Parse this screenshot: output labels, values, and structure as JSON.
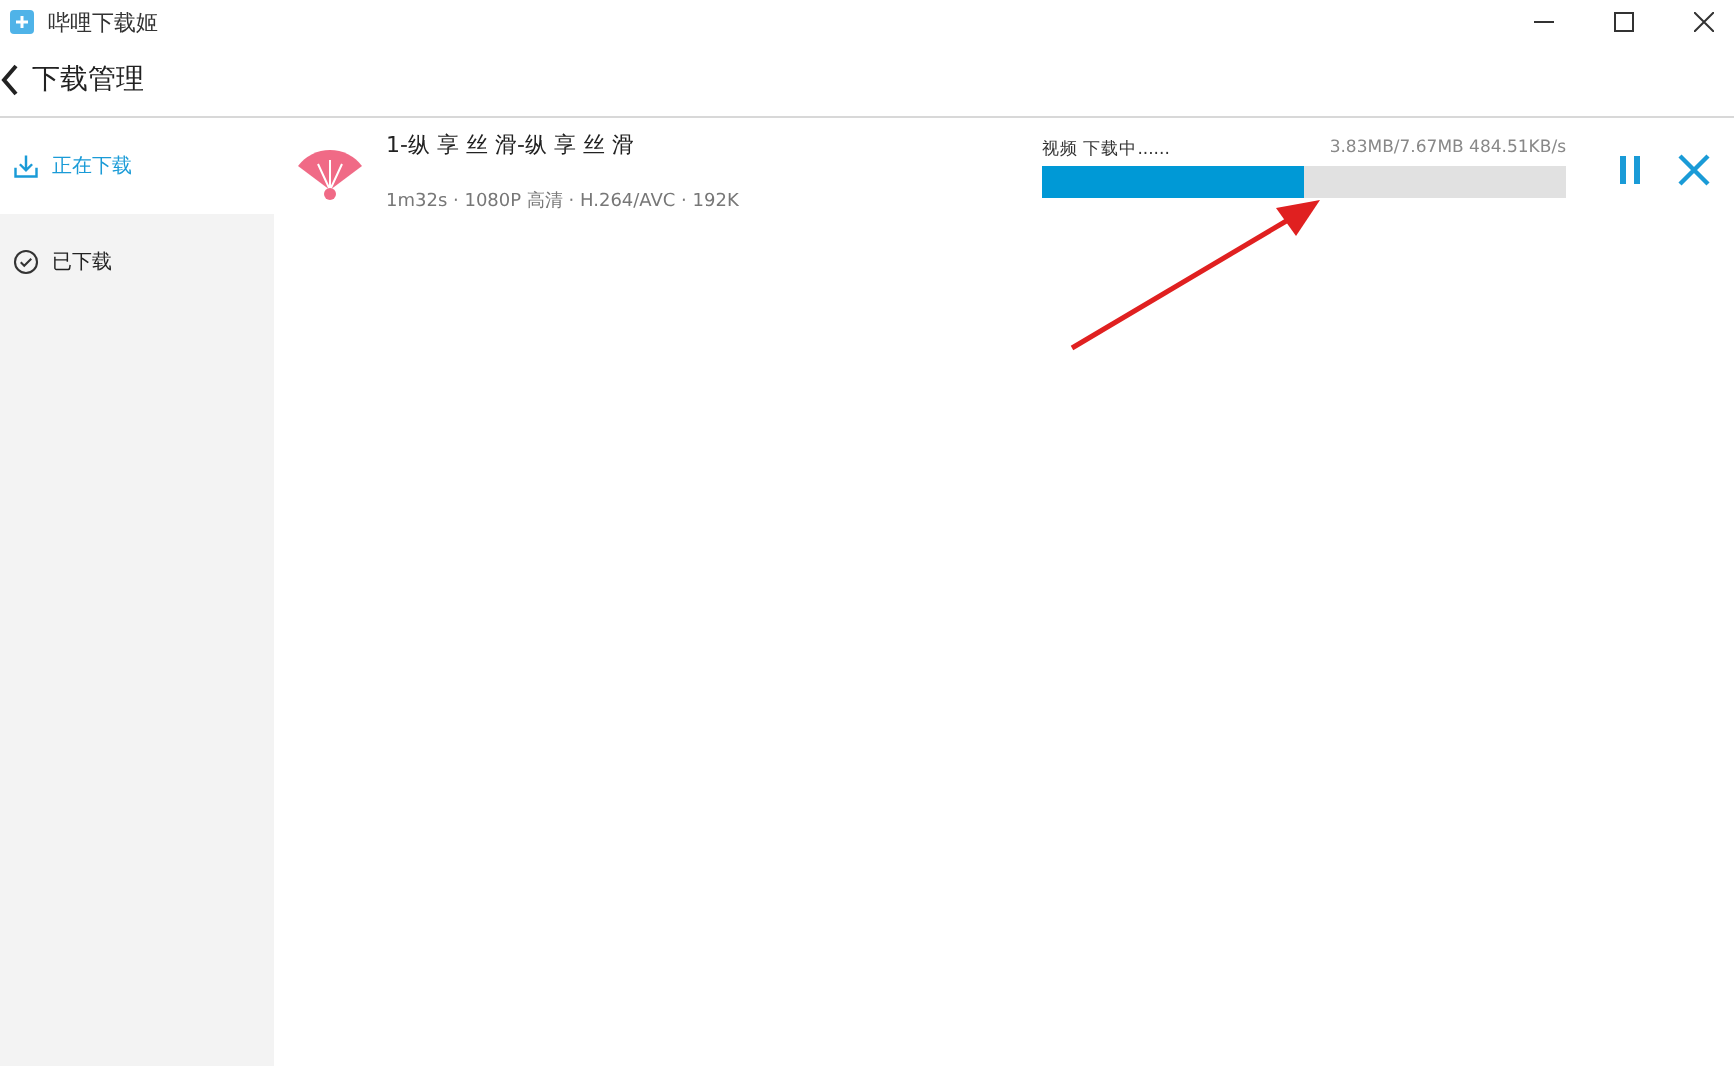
{
  "window": {
    "title": "哔哩下载姬"
  },
  "header": {
    "title": "下载管理"
  },
  "sidebar": {
    "items": [
      {
        "label": "正在下载",
        "kind": "downloading",
        "selected": true
      },
      {
        "label": "已下载",
        "kind": "downloaded",
        "selected": false
      }
    ]
  },
  "downloads": [
    {
      "title": "1-纵 享 丝 滑-纵 享 丝 滑",
      "details": "1m32s · 1080P 高清 · H.264/AVC · 192K",
      "status": "视频 下载中......",
      "progress_text": "3.83MB/7.67MB 484.51KB/s",
      "level": 0.5
    }
  ]
}
